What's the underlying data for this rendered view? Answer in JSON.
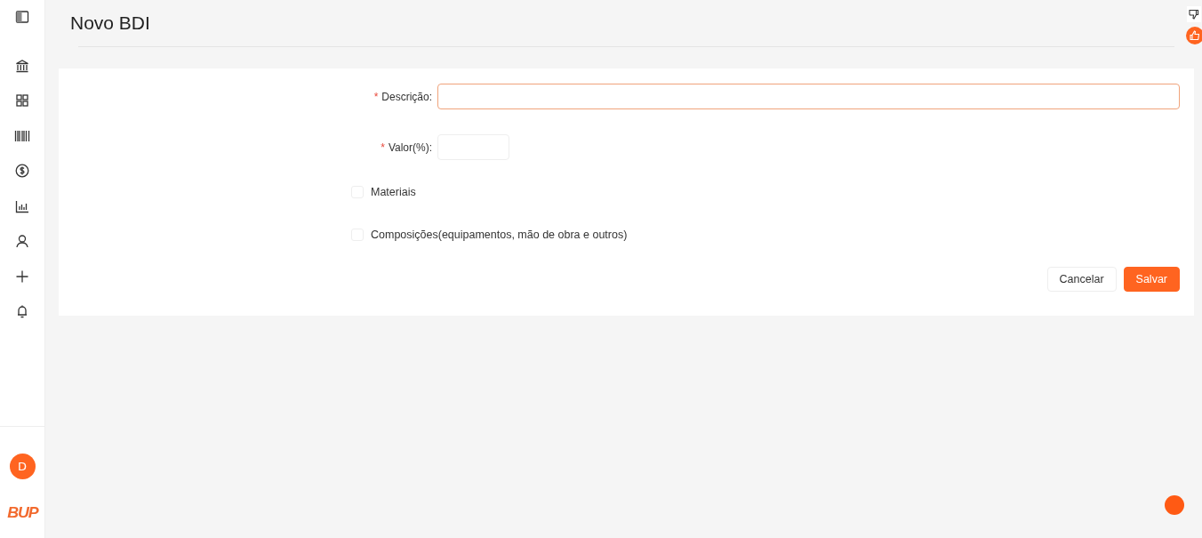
{
  "sidebar": {
    "items": [
      {
        "kind": "panel"
      },
      {
        "kind": "bank"
      },
      {
        "kind": "grid"
      },
      {
        "kind": "barcode"
      },
      {
        "kind": "dollar"
      },
      {
        "kind": "chart"
      },
      {
        "kind": "user"
      },
      {
        "kind": "plus"
      },
      {
        "kind": "bell"
      }
    ],
    "avatar": "D",
    "logo": "BUP"
  },
  "page": {
    "title": "Novo BDI"
  },
  "form": {
    "fields": [
      {
        "required_mark": "*",
        "label": "Descrição:",
        "focused": true,
        "wide": true
      },
      {
        "required_mark": "*",
        "label": "Valor(%):",
        "focused": false,
        "wide": false
      }
    ],
    "checkboxes": [
      {
        "label": "Materiais",
        "checked": false
      },
      {
        "label": "Composições(equipamentos, mão de obra e outros)",
        "checked": false
      }
    ],
    "buttons": [
      {
        "label": "Cancelar",
        "kind": "default"
      },
      {
        "label": "Salvar",
        "kind": "primary"
      }
    ]
  }
}
